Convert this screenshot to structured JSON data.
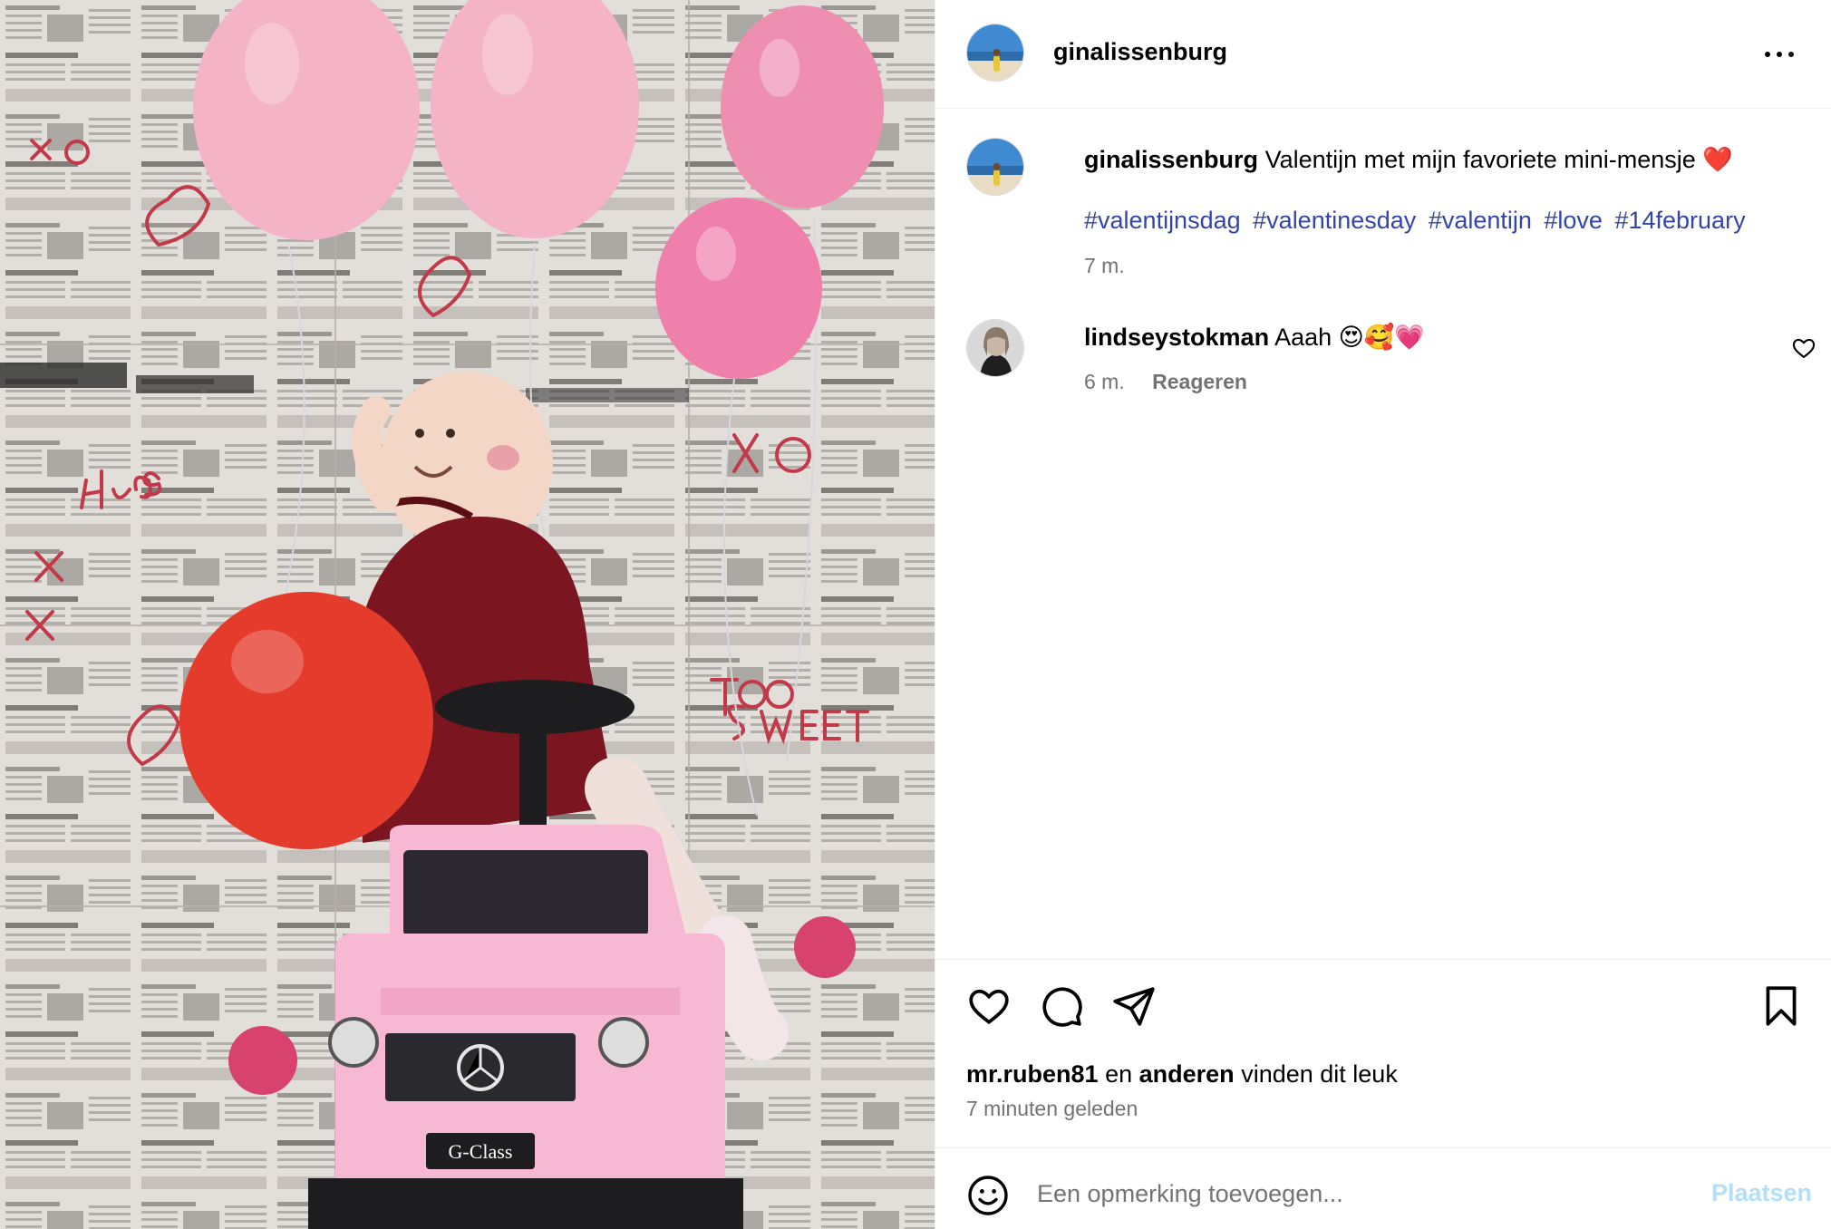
{
  "post": {
    "username": "ginalissenburg",
    "more_label": "Meer opties",
    "caption": {
      "username": "ginalissenburg",
      "text": "Valentijn met mijn favoriete mini-mensje",
      "emoji": "❤️",
      "hashtags": [
        "#valentijnsdag",
        "#valentinesday",
        "#valentijn",
        "#love",
        "#14february"
      ],
      "time": "7 m."
    },
    "comments": [
      {
        "username": "lindseystokman",
        "text": "Aaah 😍🥰💗",
        "time": "6 m.",
        "reply_label": "Reageren"
      }
    ],
    "likes": {
      "first_user": "mr.ruben81",
      "connector": "en",
      "others": "anderen",
      "suffix": "vinden dit leuk"
    },
    "timestamp": "7 minuten geleden",
    "add_comment": {
      "placeholder": "Een opmerking toevoegen...",
      "post_label": "Plaatsen"
    }
  },
  "photo": {
    "car_badge": "G-Class",
    "wall_words": [
      "Hugs",
      "XO",
      "Too",
      "SWEET"
    ]
  },
  "colors": {
    "link": "#3445a8",
    "muted": "#737373",
    "post_button_disabled": "#b2dffc",
    "balloon_red": "#e53b2c",
    "balloon_pink": "#f2a3bf",
    "car_pink": "#f6b8d3"
  },
  "icons": {
    "like": "heart-icon",
    "comment": "comment-bubble-icon",
    "share": "paper-plane-icon",
    "save": "bookmark-icon",
    "emoji": "smiley-icon",
    "more": "ellipsis-icon"
  }
}
